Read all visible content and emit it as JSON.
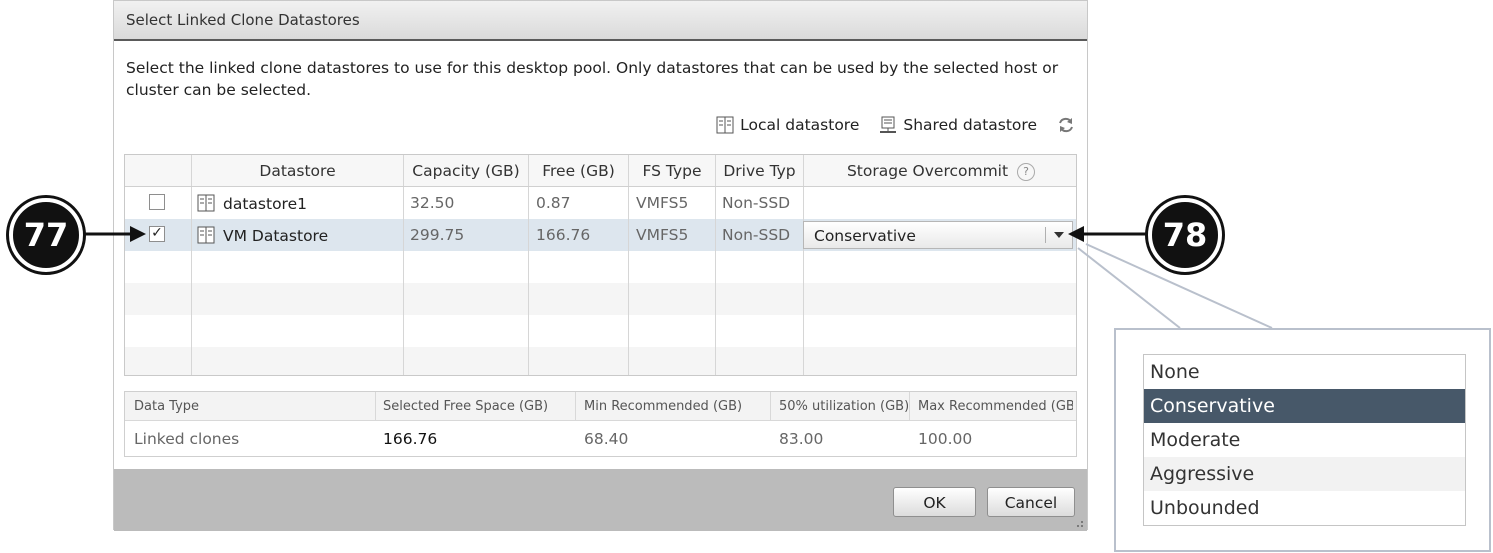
{
  "dialog": {
    "title": "Select Linked Clone Datastores",
    "intro": "Select the linked clone datastores to use for this desktop pool. Only datastores that can be used by the selected host or cluster can be selected.",
    "legend": {
      "local_icon": "local-datastore-icon",
      "local_label": "Local datastore",
      "shared_icon": "shared-datastore-icon",
      "shared_label": "Shared datastore",
      "refresh_icon": "refresh-icon"
    },
    "grid": {
      "columns": [
        "",
        "Datastore",
        "Capacity (GB)",
        "Free (GB)",
        "FS Type",
        "Drive Typ",
        "Storage Overcommit"
      ],
      "help_icon": "?",
      "rows": [
        {
          "checked": false,
          "check": "",
          "datastore": "datastore1",
          "capacity": "32.50",
          "free": "0.87",
          "fs_type": "VMFS5",
          "drive_type": "Non-SSD",
          "overcommit": ""
        },
        {
          "checked": true,
          "check": "✓",
          "datastore": "VM Datastore",
          "capacity": "299.75",
          "free": "166.76",
          "fs_type": "VMFS5",
          "drive_type": "Non-SSD",
          "overcommit": "Conservative"
        }
      ]
    },
    "summary": {
      "headers": [
        "Data Type",
        "Selected Free Space (GB)",
        "Min Recommended (GB)",
        "50% utilization (GB)",
        "Max Recommended (GB)"
      ],
      "row": [
        "Linked clones",
        "166.76",
        "68.40",
        "83.00",
        "100.00"
      ]
    },
    "buttons": {
      "ok": "OK",
      "cancel": "Cancel"
    }
  },
  "callouts": {
    "left": "77",
    "right": "78"
  },
  "popup": {
    "options": [
      "None",
      "Conservative",
      "Moderate",
      "Aggressive",
      "Unbounded"
    ],
    "selected": "Conservative"
  },
  "colors": {
    "selected_option": "#475869",
    "selected_row": "#dde6ee",
    "footer": "#bbbbbb"
  }
}
